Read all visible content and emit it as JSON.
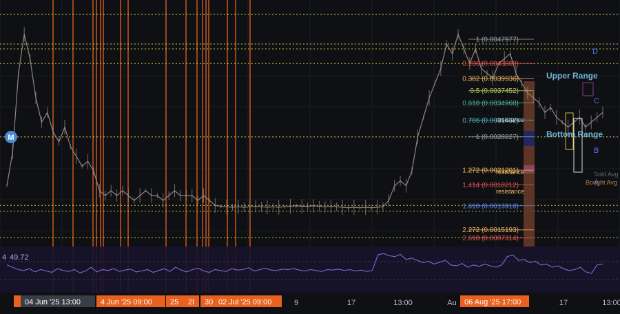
{
  "chart_data": {
    "type": "line",
    "title": "",
    "xlabel": "",
    "ylabel": "",
    "ylim": [
      0.0006,
      0.0056
    ],
    "price": [
      0.0018,
      0.0025,
      0.0041,
      0.0049,
      0.0044,
      0.0036,
      0.0031,
      0.0033,
      0.0029,
      0.0027,
      0.003,
      0.0026,
      0.0024,
      0.0022,
      0.0023,
      0.0021,
      0.0017,
      0.0016,
      0.0017,
      0.0016,
      0.0017,
      0.0016,
      0.0015,
      0.0016,
      0.0017,
      0.0016,
      0.0016,
      0.0015,
      0.0016,
      0.0017,
      0.0016,
      0.0016,
      0.0016,
      0.0015,
      0.0016,
      0.0015,
      0.0014,
      0.00138,
      0.00137,
      0.00136,
      0.00137,
      0.00136,
      0.00137,
      0.00138,
      0.00137,
      0.00136,
      0.00137,
      0.00136,
      0.00137,
      0.00138,
      0.00139,
      0.00138,
      0.00138,
      0.00139,
      0.00138,
      0.00137,
      0.00138,
      0.00137,
      0.00136,
      0.00135,
      0.00136,
      0.00135,
      0.00136,
      0.00135,
      0.00136,
      0.00137,
      0.0015,
      0.0018,
      0.0019,
      0.0018,
      0.0021,
      0.0028,
      0.0032,
      0.0036,
      0.0039,
      0.0042,
      0.0047,
      0.0045,
      0.0049,
      0.0046,
      0.0043,
      0.0046,
      0.0042,
      0.0041,
      0.004,
      0.0043,
      0.0044,
      0.0045,
      0.0041,
      0.0039,
      0.0037,
      0.0036,
      0.0035,
      0.0033,
      0.0034,
      0.0032,
      0.0031,
      0.003,
      0.0031,
      0.0032,
      0.003,
      0.0031,
      0.0032,
      0.0033
    ],
    "rsi": {
      "value_label": "49.72",
      "left_value": "4",
      "values": [
        60,
        55,
        50,
        48,
        52,
        45,
        50,
        47,
        44,
        52,
        48,
        46,
        50,
        43,
        47,
        55,
        45,
        50,
        48,
        52,
        46,
        49,
        51,
        45,
        47,
        50,
        44,
        48,
        52,
        46,
        55,
        49,
        45,
        50,
        53,
        47,
        44,
        50,
        48,
        46,
        52,
        49,
        50,
        54,
        47,
        50,
        53,
        49,
        48,
        51,
        50,
        52,
        49,
        47,
        50,
        48,
        46,
        50,
        49,
        51,
        48,
        50,
        47,
        49,
        46,
        48,
        82,
        85,
        80,
        78,
        83,
        72,
        75,
        70,
        65,
        68,
        62,
        66,
        70,
        60,
        58,
        63,
        55,
        60,
        57,
        62,
        58,
        55,
        60,
        78,
        82,
        70,
        72,
        65,
        68,
        60,
        62,
        55,
        58,
        52,
        48,
        50,
        55,
        45,
        42,
        60,
        62
      ]
    },
    "fib_levels": [
      {
        "ratio": "1",
        "value": "0.0047977",
        "price": 0.0047977,
        "color": "#9aa0a6"
      },
      {
        "ratio": "0.236",
        "value": "0.0043009",
        "price": 0.0043009,
        "color": "#e2524f"
      },
      {
        "ratio": "0.382",
        "value": "0.0039936",
        "price": 0.0039936,
        "color": "#f0b35a"
      },
      {
        "ratio": "0.5",
        "value": "0.0037452",
        "price": 0.0037452,
        "color": "#b8c95a"
      },
      {
        "ratio": "0.618",
        "value": "0.0034968",
        "price": 0.0034968,
        "color": "#4fb88a"
      },
      {
        "ratio": "0.786",
        "value": "0.0031432",
        "price": 0.0031432,
        "color": "#4fb8c0"
      },
      {
        "ratio": "1",
        "value": "0.0028027",
        "price": 0.0028027,
        "color": "#9aa0a6"
      },
      {
        "ratio": "1.272",
        "value": "0.0021201",
        "price": 0.0021201,
        "color": "#f0b35a"
      },
      {
        "ratio": "1.414",
        "value": "0.0018212",
        "price": 0.0018212,
        "color": "#e2524f"
      },
      {
        "ratio": "1.618",
        "value": "0.0013918",
        "price": 0.0013918,
        "color": "#5a7de0"
      },
      {
        "ratio": "2.272",
        "value": "0.0015193",
        "price": 0.0009,
        "color": "#f0b35a"
      },
      {
        "ratio": "2.618",
        "value": "0.0007314",
        "price": 0.0007314,
        "color": "#e2524f"
      }
    ],
    "dotted_levels": [
      0.0053,
      0.0047,
      0.0046,
      0.0043,
      0.0028,
      0.0014,
      0.00128,
      0.00074
    ],
    "annotations": {
      "upper_range": "Upper Range",
      "bottom_range": "Bottom Range",
      "wave_labels": [
        "D",
        "C",
        "B",
        "A"
      ],
      "resistance": "resistance",
      "sold_avg": "Sold Avg",
      "bought_avg": "Bought Avg",
      "marker": "M"
    },
    "x_ticks": [
      "9",
      "17",
      "13:00",
      "Au",
      "17",
      "13:00"
    ],
    "highlight_labels": [
      {
        "text": "04 Jun '25  13:00",
        "color": "#3a3d45"
      },
      {
        "text": "4 Jun '25  09:00",
        "color": "#e8611e"
      },
      {
        "text": "25",
        "color": "#e8611e"
      },
      {
        "text": "2l",
        "color": "#e8611e"
      },
      {
        "text": "30",
        "color": "#e8611e"
      },
      {
        "text": "02 Jul '25  09:00",
        "color": "#e8611e"
      },
      {
        "text": "06 Aug '25  17:00",
        "color": "#e8611e"
      }
    ],
    "colors": {
      "bg": "#0f1014",
      "price": "#a09288",
      "rsi": "#7f6bd6",
      "orange": "#e8611e",
      "fib_line": "#f5e94a"
    }
  }
}
